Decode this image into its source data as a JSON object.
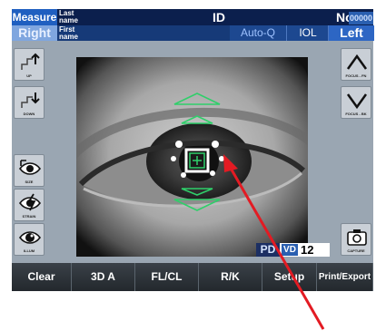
{
  "header": {
    "mode": "Measure",
    "last_name_label": "Last name",
    "first_name_label": "First name",
    "id_label": "ID",
    "no_label": "No.",
    "no_value": "00000",
    "eye_current": "Right",
    "auto_label": "Auto-Q",
    "iol_label": "IOL",
    "eye_other": "Left"
  },
  "side_left": [
    {
      "caption": "UP",
      "icon": "up-arrow-icon"
    },
    {
      "caption": "DOWN",
      "icon": "down-arrow-icon"
    },
    {
      "caption": "SIZE",
      "icon": "eye-size-icon"
    },
    {
      "caption": "STRAIN",
      "icon": "eye-strain-icon"
    },
    {
      "caption": "ILLUM",
      "icon": "eye-illum-icon"
    }
  ],
  "side_right": [
    {
      "caption": "FOCUS - FN",
      "icon": "chevron-up-icon"
    },
    {
      "caption": "FOCUS - BK",
      "icon": "chevron-down-icon"
    },
    {
      "caption": "CAPTURE",
      "icon": "camera-icon"
    }
  ],
  "status": {
    "pd_label": "PD",
    "vd_label": "VD",
    "vd_value": "12"
  },
  "tabs": [
    "Clear",
    "3D A",
    "FL/CL",
    "R/K",
    "Setup",
    "Print/Export"
  ],
  "colors": {
    "annotation_arrow": "#e31b23",
    "target_green": "#2fcf6a"
  }
}
